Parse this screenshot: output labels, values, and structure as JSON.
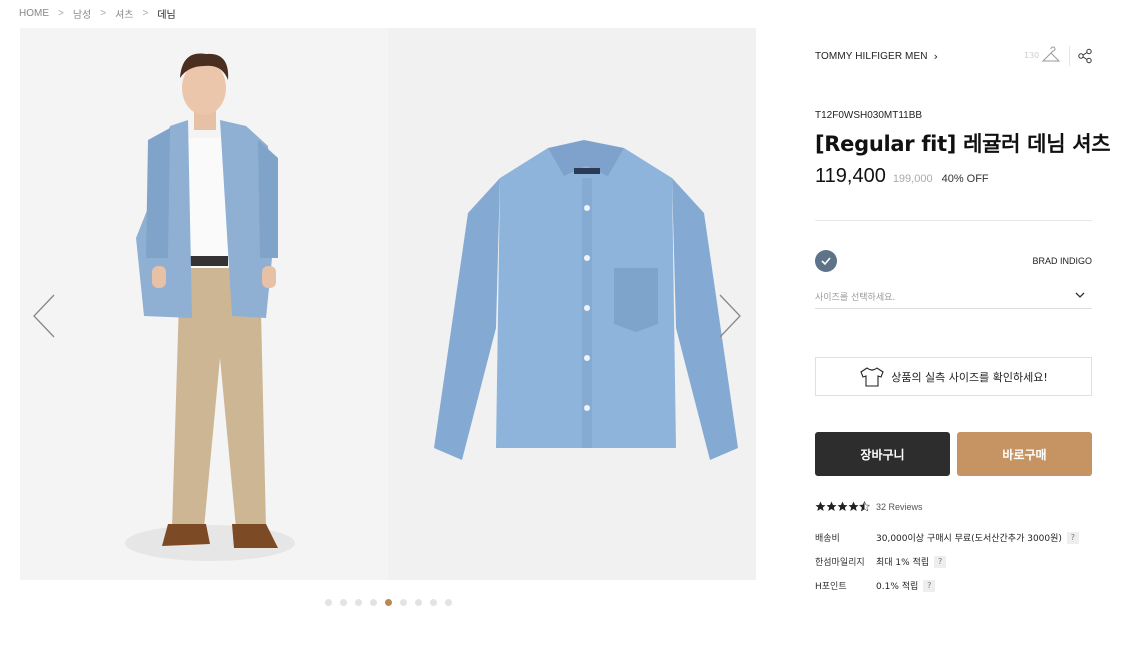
{
  "breadcrumb": {
    "items": [
      "HOME",
      "남성",
      "셔츠",
      "데님"
    ],
    "separator": ">"
  },
  "gallery": {
    "dots_count": 9,
    "active_dot": 5,
    "active_color": "#b88955"
  },
  "product": {
    "brand": "TOMMY HILFIGER MEN",
    "like_count": "130",
    "code": "T12F0WSH030MT11BB",
    "title": "[Regular fit] 레귤러 데님 셔츠",
    "price": "119,400",
    "original_price": "199,000",
    "discount": "40% OFF"
  },
  "options": {
    "color_name": "BRAD INDIGO",
    "swatch_color": "#5f7388",
    "size_placeholder": "사이즈를 선택하세요."
  },
  "size_guide": {
    "label": "상품의 실측 사이즈를 확인하세요!"
  },
  "actions": {
    "cart_label": "장바구니",
    "buy_label": "바로구매",
    "buy_color": "#c69462"
  },
  "rating": {
    "score": 4.5,
    "max": 5,
    "review_text": "32 Reviews"
  },
  "info": {
    "rows": [
      {
        "label": "배송비",
        "value": "30,000이상 구매시 무료(도서산간추가 3000원)",
        "help": "?"
      },
      {
        "label": "한섬마일리지",
        "value": "최대 1% 적립",
        "help": "?"
      },
      {
        "label": "H포인트",
        "value": "0.1% 적립",
        "help": "?"
      }
    ]
  }
}
